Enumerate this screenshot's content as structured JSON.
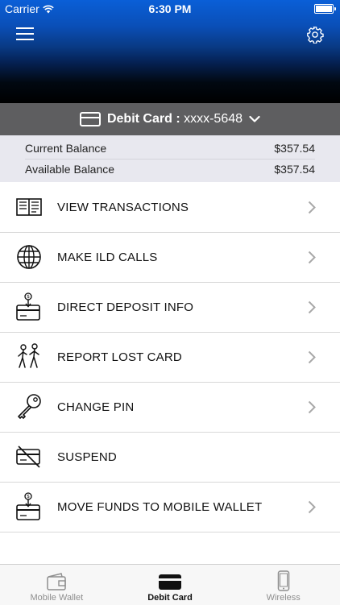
{
  "status_bar": {
    "carrier": "Carrier",
    "time": "6:30 PM"
  },
  "card_selector": {
    "title": "Debit Card :",
    "masked_number": "xxxx-5648"
  },
  "balances": [
    {
      "label": "Current Balance",
      "value": "$357.54"
    },
    {
      "label": "Available Balance",
      "value": "$357.54"
    }
  ],
  "menu": [
    {
      "label": "VIEW TRANSACTIONS",
      "icon": "ledger-icon",
      "chevron": true
    },
    {
      "label": "MAKE ILD CALLS",
      "icon": "globe-icon",
      "chevron": true
    },
    {
      "label": "DIRECT DEPOSIT INFO",
      "icon": "deposit-card-icon",
      "chevron": true
    },
    {
      "label": "REPORT LOST CARD",
      "icon": "people-walking-icon",
      "chevron": true
    },
    {
      "label": "CHANGE PIN",
      "icon": "key-icon",
      "chevron": true
    },
    {
      "label": "SUSPEND",
      "icon": "card-blocked-icon",
      "chevron": false
    },
    {
      "label": "MOVE FUNDS TO MOBILE WALLET",
      "icon": "deposit-card-icon",
      "chevron": true
    }
  ],
  "tabs": [
    {
      "label": "Mobile Wallet",
      "icon": "wallet-icon",
      "active": false
    },
    {
      "label": "Debit Card",
      "icon": "card-icon",
      "active": true
    },
    {
      "label": "Wireless",
      "icon": "phone-icon",
      "active": false
    }
  ],
  "colors": {
    "header_top": "#0a5fd8",
    "header_bottom": "#000000",
    "card_bar": "#5e5e60",
    "balances_bg": "#e8e8ef"
  }
}
